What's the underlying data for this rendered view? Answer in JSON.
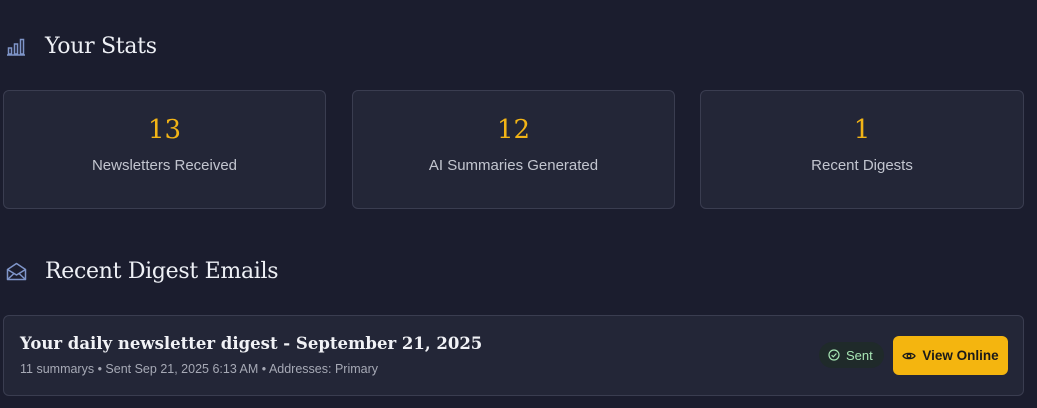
{
  "stats_section": {
    "title": "Your Stats",
    "icon": "bar-chart-icon",
    "cards": [
      {
        "value": "13",
        "label": "Newsletters Received"
      },
      {
        "value": "12",
        "label": "AI Summaries Generated"
      },
      {
        "value": "1",
        "label": "Recent Digests"
      }
    ]
  },
  "digests_section": {
    "title": "Recent Digest Emails",
    "icon": "envelope-open-icon",
    "items": [
      {
        "title": "Your daily newsletter digest - September 21, 2025",
        "meta": "11 summarys • Sent Sep 21, 2025 6:13 AM • Addresses: Primary",
        "status": "Sent",
        "status_icon": "check-circle-icon",
        "action_label": "View Online",
        "action_icon": "eye-icon"
      }
    ]
  },
  "colors": {
    "background": "#1b1d2e",
    "card": "#232637",
    "accent": "#f4b50f",
    "status_text": "#a7e5b4"
  }
}
